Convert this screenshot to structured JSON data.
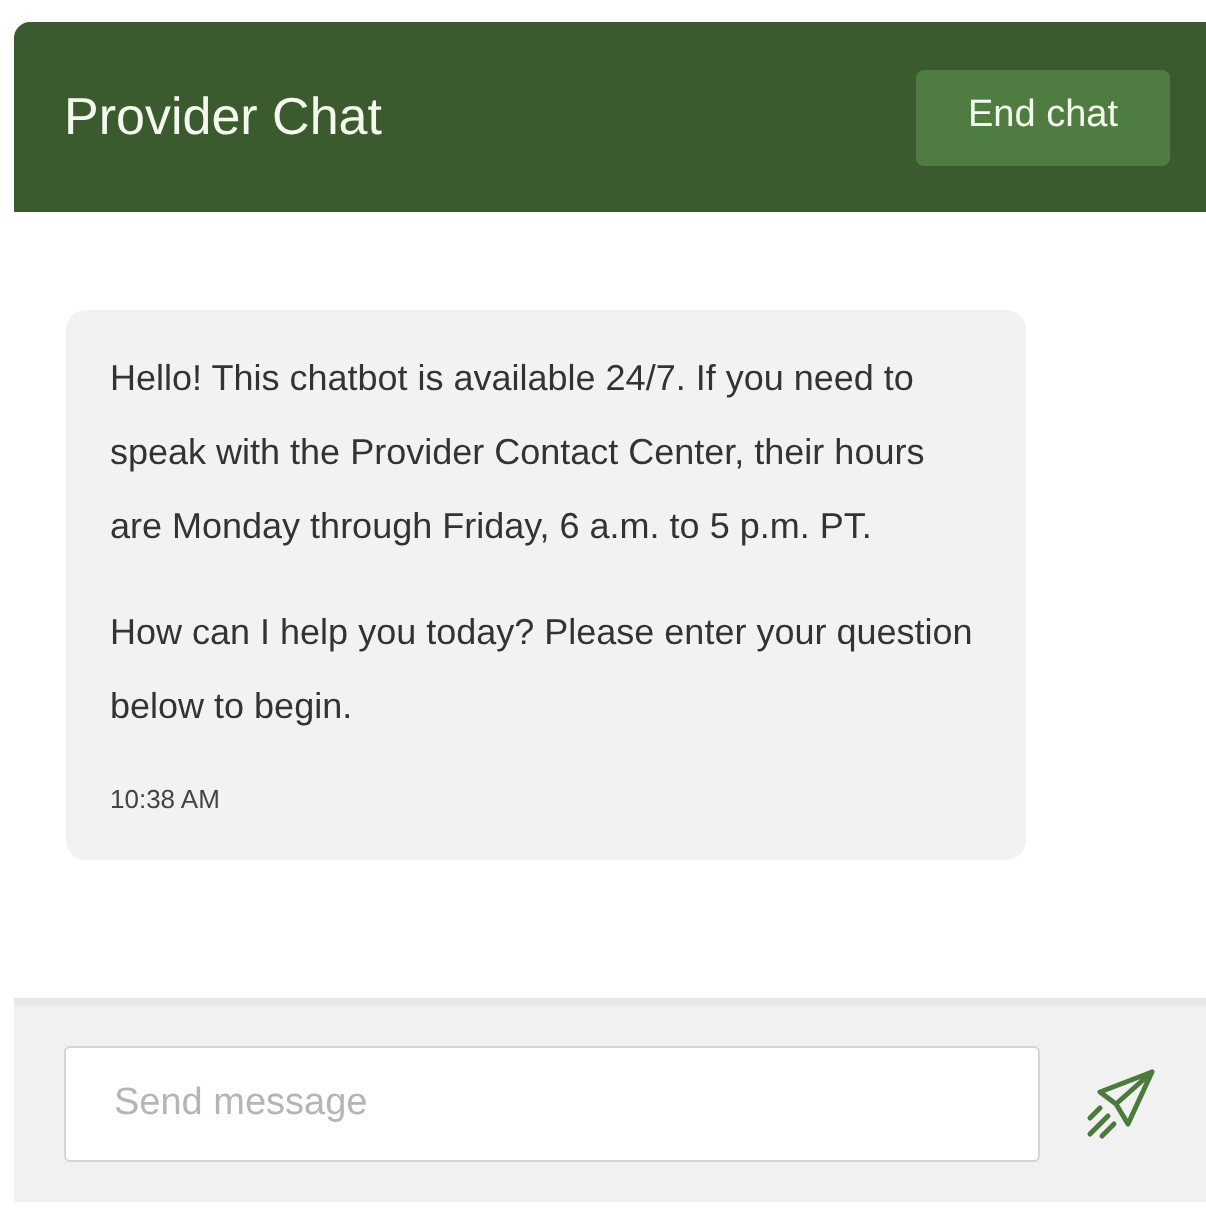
{
  "header": {
    "title": "Provider Chat",
    "end_button": "End chat"
  },
  "messages": [
    {
      "paragraphs": [
        "Hello! This chatbot is available 24/7. If you need to speak with the Provider Contact Center, their hours are Monday through Friday, 6 a.m. to 5 p.m. PT.",
        "How can I help you today? Please enter your question below to begin."
      ],
      "time": "10:38 AM"
    }
  ],
  "composer": {
    "placeholder": "Send message"
  }
}
